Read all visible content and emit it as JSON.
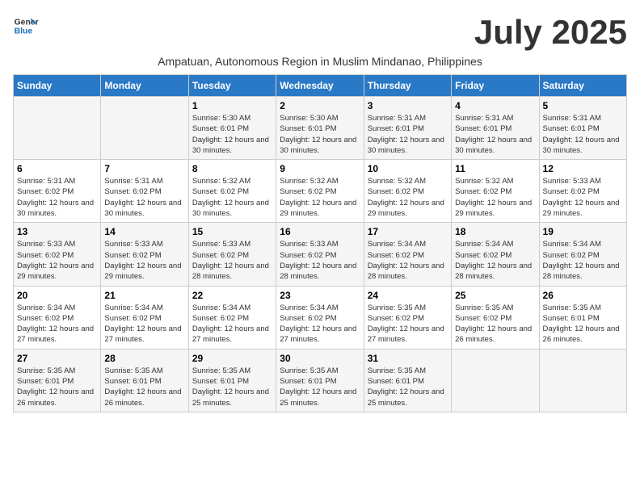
{
  "logo": {
    "line1": "General",
    "line2": "Blue"
  },
  "title": "July 2025",
  "subtitle": "Ampatuan, Autonomous Region in Muslim Mindanao, Philippines",
  "days_of_week": [
    "Sunday",
    "Monday",
    "Tuesday",
    "Wednesday",
    "Thursday",
    "Friday",
    "Saturday"
  ],
  "weeks": [
    [
      {
        "day": "",
        "detail": ""
      },
      {
        "day": "",
        "detail": ""
      },
      {
        "day": "1",
        "detail": "Sunrise: 5:30 AM\nSunset: 6:01 PM\nDaylight: 12 hours and 30 minutes."
      },
      {
        "day": "2",
        "detail": "Sunrise: 5:30 AM\nSunset: 6:01 PM\nDaylight: 12 hours and 30 minutes."
      },
      {
        "day": "3",
        "detail": "Sunrise: 5:31 AM\nSunset: 6:01 PM\nDaylight: 12 hours and 30 minutes."
      },
      {
        "day": "4",
        "detail": "Sunrise: 5:31 AM\nSunset: 6:01 PM\nDaylight: 12 hours and 30 minutes."
      },
      {
        "day": "5",
        "detail": "Sunrise: 5:31 AM\nSunset: 6:01 PM\nDaylight: 12 hours and 30 minutes."
      }
    ],
    [
      {
        "day": "6",
        "detail": "Sunrise: 5:31 AM\nSunset: 6:02 PM\nDaylight: 12 hours and 30 minutes."
      },
      {
        "day": "7",
        "detail": "Sunrise: 5:31 AM\nSunset: 6:02 PM\nDaylight: 12 hours and 30 minutes."
      },
      {
        "day": "8",
        "detail": "Sunrise: 5:32 AM\nSunset: 6:02 PM\nDaylight: 12 hours and 30 minutes."
      },
      {
        "day": "9",
        "detail": "Sunrise: 5:32 AM\nSunset: 6:02 PM\nDaylight: 12 hours and 29 minutes."
      },
      {
        "day": "10",
        "detail": "Sunrise: 5:32 AM\nSunset: 6:02 PM\nDaylight: 12 hours and 29 minutes."
      },
      {
        "day": "11",
        "detail": "Sunrise: 5:32 AM\nSunset: 6:02 PM\nDaylight: 12 hours and 29 minutes."
      },
      {
        "day": "12",
        "detail": "Sunrise: 5:33 AM\nSunset: 6:02 PM\nDaylight: 12 hours and 29 minutes."
      }
    ],
    [
      {
        "day": "13",
        "detail": "Sunrise: 5:33 AM\nSunset: 6:02 PM\nDaylight: 12 hours and 29 minutes."
      },
      {
        "day": "14",
        "detail": "Sunrise: 5:33 AM\nSunset: 6:02 PM\nDaylight: 12 hours and 29 minutes."
      },
      {
        "day": "15",
        "detail": "Sunrise: 5:33 AM\nSunset: 6:02 PM\nDaylight: 12 hours and 28 minutes."
      },
      {
        "day": "16",
        "detail": "Sunrise: 5:33 AM\nSunset: 6:02 PM\nDaylight: 12 hours and 28 minutes."
      },
      {
        "day": "17",
        "detail": "Sunrise: 5:34 AM\nSunset: 6:02 PM\nDaylight: 12 hours and 28 minutes."
      },
      {
        "day": "18",
        "detail": "Sunrise: 5:34 AM\nSunset: 6:02 PM\nDaylight: 12 hours and 28 minutes."
      },
      {
        "day": "19",
        "detail": "Sunrise: 5:34 AM\nSunset: 6:02 PM\nDaylight: 12 hours and 28 minutes."
      }
    ],
    [
      {
        "day": "20",
        "detail": "Sunrise: 5:34 AM\nSunset: 6:02 PM\nDaylight: 12 hours and 27 minutes."
      },
      {
        "day": "21",
        "detail": "Sunrise: 5:34 AM\nSunset: 6:02 PM\nDaylight: 12 hours and 27 minutes."
      },
      {
        "day": "22",
        "detail": "Sunrise: 5:34 AM\nSunset: 6:02 PM\nDaylight: 12 hours and 27 minutes."
      },
      {
        "day": "23",
        "detail": "Sunrise: 5:34 AM\nSunset: 6:02 PM\nDaylight: 12 hours and 27 minutes."
      },
      {
        "day": "24",
        "detail": "Sunrise: 5:35 AM\nSunset: 6:02 PM\nDaylight: 12 hours and 27 minutes."
      },
      {
        "day": "25",
        "detail": "Sunrise: 5:35 AM\nSunset: 6:02 PM\nDaylight: 12 hours and 26 minutes."
      },
      {
        "day": "26",
        "detail": "Sunrise: 5:35 AM\nSunset: 6:01 PM\nDaylight: 12 hours and 26 minutes."
      }
    ],
    [
      {
        "day": "27",
        "detail": "Sunrise: 5:35 AM\nSunset: 6:01 PM\nDaylight: 12 hours and 26 minutes."
      },
      {
        "day": "28",
        "detail": "Sunrise: 5:35 AM\nSunset: 6:01 PM\nDaylight: 12 hours and 26 minutes."
      },
      {
        "day": "29",
        "detail": "Sunrise: 5:35 AM\nSunset: 6:01 PM\nDaylight: 12 hours and 25 minutes."
      },
      {
        "day": "30",
        "detail": "Sunrise: 5:35 AM\nSunset: 6:01 PM\nDaylight: 12 hours and 25 minutes."
      },
      {
        "day": "31",
        "detail": "Sunrise: 5:35 AM\nSunset: 6:01 PM\nDaylight: 12 hours and 25 minutes."
      },
      {
        "day": "",
        "detail": ""
      },
      {
        "day": "",
        "detail": ""
      }
    ]
  ]
}
